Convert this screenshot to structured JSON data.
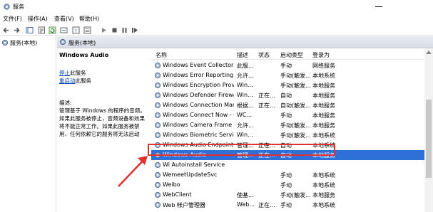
{
  "window": {
    "title": "服务",
    "colors": {
      "accent": "#2f6fd8",
      "annotation": "#e03030",
      "link": "#0645ad"
    }
  },
  "menu": [
    "文件(F)",
    "操作(A)",
    "查看(V)",
    "帮助(H)"
  ],
  "toolbar_icons": [
    "back-arrow-icon",
    "forward-arrow-icon",
    "console-tree-icon",
    "properties-icon",
    "refresh-icon",
    "export-icon",
    "help-icon",
    "detail-view-icon",
    "play-icon",
    "stop-icon",
    "pause-icon",
    "restart-icon"
  ],
  "tree": {
    "root": "服务(本地)"
  },
  "content_header": "服务(本地)",
  "description": {
    "service_name": "Windows Audio",
    "stop_link": "停止",
    "stop_suffix": "此服务",
    "restart_link": "重启动",
    "restart_suffix": "此服务",
    "label": "描述:",
    "text": "管理基于 Windows 的程序的音频。如果此服务被停止，音频设备和效果将不能正常工作。如果此服务被禁用，任何依赖它的服务将无法启动"
  },
  "columns": [
    "名称",
    "描述",
    "状态",
    "启动类型",
    "登录为"
  ],
  "services": [
    {
      "name": "Windows Event Collector",
      "desc": "此服...",
      "status": "",
      "startup": "手动",
      "logon": "网络服务"
    },
    {
      "name": "Windows Error Reporting S...",
      "desc": "允许...",
      "status": "",
      "startup": "手动(触发...",
      "logon": "本地系统"
    },
    {
      "name": "Windows Encryption Provid...",
      "desc": "Win...",
      "status": "",
      "startup": "手动(触发...",
      "logon": "本地服务"
    },
    {
      "name": "Windows Defender Firewall",
      "desc": "Win...",
      "status": "正在...",
      "startup": "自动",
      "logon": "本地服务"
    },
    {
      "name": "Windows Connection Man...",
      "desc": "根据...",
      "status": "正在...",
      "startup": "自动(触发...",
      "logon": "本地服务"
    },
    {
      "name": "Windows Connect Now - C...",
      "desc": "WC...",
      "status": "",
      "startup": "手动",
      "logon": "本地服务"
    },
    {
      "name": "Windows Camera Frame S...",
      "desc": "允许...",
      "status": "",
      "startup": "手动(触发...",
      "logon": "本地服务"
    },
    {
      "name": "Windows Biometric Service",
      "desc": "Win...",
      "status": "",
      "startup": "手动(触发...",
      "logon": "本地系统"
    },
    {
      "name": "Windows Audio Endpoint B...",
      "desc": "管理...",
      "status": "正在...",
      "startup": "自动",
      "logon": "本地系统"
    },
    {
      "name": "Windows Audio",
      "desc": "管理...",
      "status": "正在...",
      "startup": "自动",
      "logon": "本地服务"
    },
    {
      "name": "Wi Autoinstall Service",
      "desc": "",
      "status": "",
      "startup": "",
      "logon": ""
    },
    {
      "name": "WemeetUpdateSvc",
      "desc": "",
      "status": "",
      "startup": "手动",
      "logon": "本地系统"
    },
    {
      "name": "Weibo",
      "desc": "",
      "status": "",
      "startup": "手动",
      "logon": "本地系统"
    },
    {
      "name": "WebClient",
      "desc": "使基...",
      "status": "",
      "startup": "手动(触发...",
      "logon": "本地服务"
    },
    {
      "name": "Web 帐户管理器",
      "desc": "Web...",
      "status": "正在...",
      "startup": "手动",
      "logon": "本地系统"
    },
    {
      "name": "WarpJITSvc",
      "desc": "Prov...",
      "status": "",
      "startup": "手动(触发...",
      "logon": "本地服务"
    }
  ],
  "selected_service_index": 9
}
